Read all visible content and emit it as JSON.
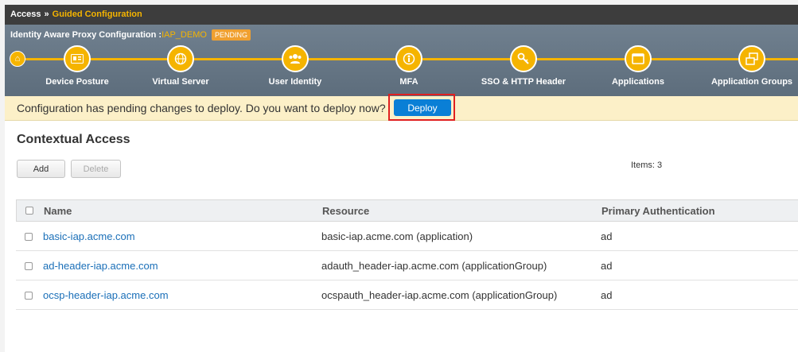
{
  "breadcrumb": {
    "root": "Access",
    "separator": "»",
    "current": "Guided Configuration"
  },
  "config": {
    "label": "Identity Aware Proxy Configuration :",
    "name": "IAP_DEMO",
    "status": "PENDING"
  },
  "wizard": {
    "steps": [
      {
        "label": "Device Posture",
        "icon": "id-card-icon"
      },
      {
        "label": "Virtual Server",
        "icon": "globe-icon"
      },
      {
        "label": "User Identity",
        "icon": "users-icon"
      },
      {
        "label": "MFA",
        "icon": "mfa-icon"
      },
      {
        "label": "SSO & HTTP Header",
        "icon": "key-icon"
      },
      {
        "label": "Applications",
        "icon": "window-icon"
      },
      {
        "label": "Application Groups",
        "icon": "windows-group-icon"
      }
    ],
    "accent": "#f5b400"
  },
  "notice": {
    "message": "Configuration has pending changes to deploy. Do you want to deploy now?",
    "deploy_label": "Deploy"
  },
  "section": {
    "title": "Contextual Access",
    "add_label": "Add",
    "delete_label": "Delete",
    "items_count": "Items: 3"
  },
  "table": {
    "columns": [
      "Name",
      "Resource",
      "Primary Authentication"
    ],
    "rows": [
      {
        "name": "basic-iap.acme.com",
        "resource": "basic-iap.acme.com (application)",
        "auth": "ad"
      },
      {
        "name": "ad-header-iap.acme.com",
        "resource": "adauth_header-iap.acme.com (applicationGroup)",
        "auth": "ad"
      },
      {
        "name": "ocsp-header-iap.acme.com",
        "resource": "ocspauth_header-iap.acme.com (applicationGroup)",
        "auth": "ad"
      }
    ]
  }
}
